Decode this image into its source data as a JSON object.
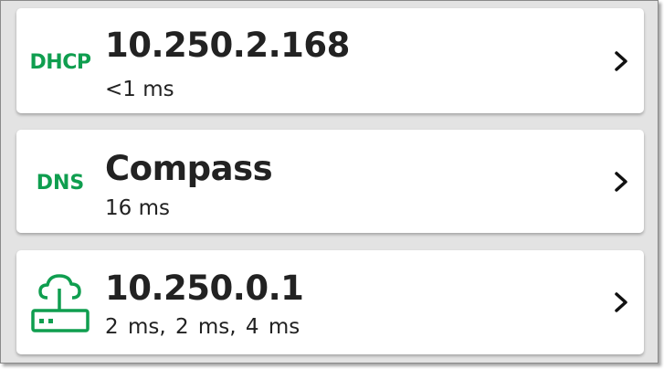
{
  "colors": {
    "accent": "#0f9e4f",
    "text": "#222222",
    "background": "#e3e3e3",
    "card": "#ffffff"
  },
  "cards": [
    {
      "badge": "DHCP",
      "title": "10.250.2.168",
      "subtitle": "<1 ms",
      "chevron_icon": "chevron-right-icon"
    },
    {
      "badge": "DNS",
      "title": "Compass",
      "subtitle": "16 ms",
      "chevron_icon": "chevron-right-icon"
    },
    {
      "icon": "gateway-cloud-router-icon",
      "title": "10.250.0.1",
      "subtitle": "2 ms,  2 ms,  4 ms",
      "chevron_icon": "chevron-right-icon"
    }
  ]
}
